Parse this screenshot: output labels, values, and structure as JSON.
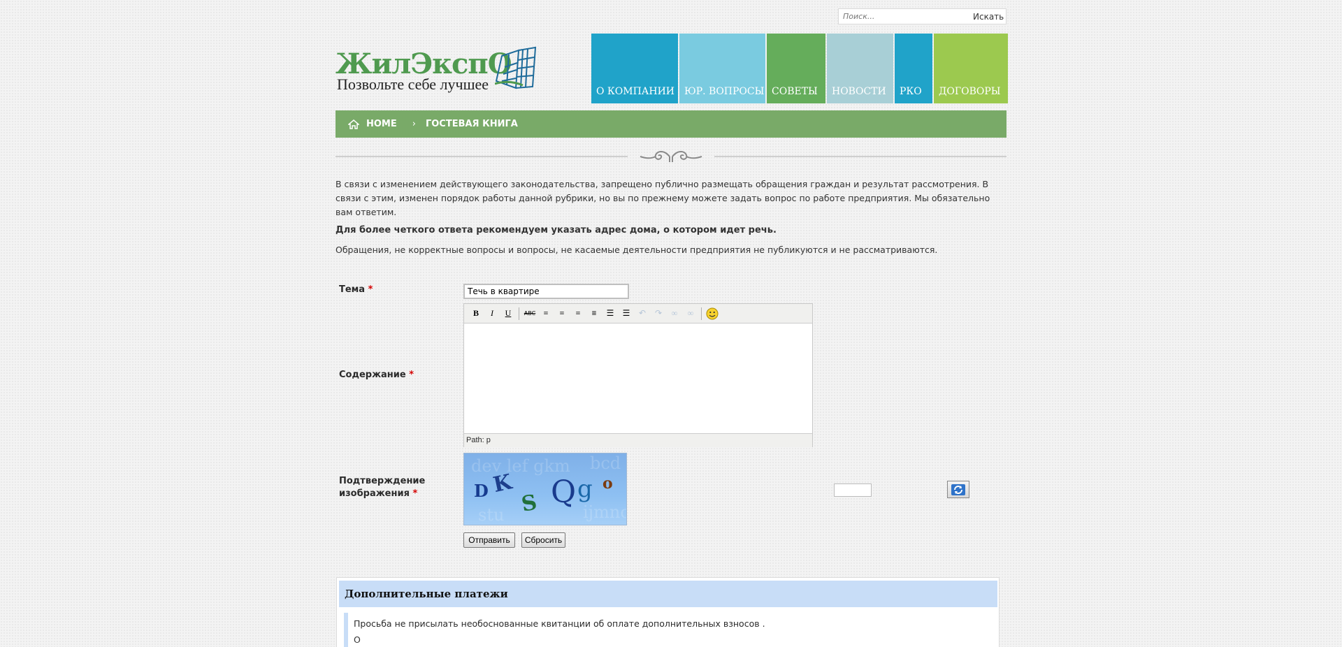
{
  "search": {
    "placeholder": "Поиск...",
    "button_label": "Искать"
  },
  "logo": {
    "title": "ЖилЭкспО",
    "tagline": "Позвольте себе лучшее"
  },
  "nav": {
    "items": [
      {
        "label": "О КОМПАНИИ",
        "color": "#20a3c9"
      },
      {
        "label": "ЮР. ВОПРОСЫ",
        "color": "#7acbe0"
      },
      {
        "label": "СОВЕТЫ",
        "color": "#65ad5b"
      },
      {
        "label": "НОВОСТИ",
        "color": "#a8cfd6"
      },
      {
        "label": "РКО",
        "color": "#20a3c9"
      },
      {
        "label": "ДОГОВОРЫ",
        "color": "#9cc94f"
      }
    ]
  },
  "breadcrumb": {
    "home": "HOME",
    "separator": "›",
    "current": "ГОСТЕВАЯ КНИГА"
  },
  "intro": {
    "p1": "В связи с изменением действующего законодательства, запрещено публично размещать обращения граждан и результат рассмотрения. В связи с этим, изменен порядок работы данной рубрики, но вы по прежнему можете задать вопрос по работе предприятия. Мы обязательно вам ответим.",
    "p2": "Для более четкого ответа рекомендуем указать адрес дома, о котором идет речь.",
    "p3": "Обращения, не корректные вопросы и вопросы, не касаемые деятельности предприятия не публикуются и не рассматриваются."
  },
  "form": {
    "subject_label": "Тема",
    "subject_value": "Течь в квартире",
    "content_label": "Содержание",
    "captcha_label_line1": "Подтверждение",
    "captcha_label_line2": "изображения",
    "required_mark": "*",
    "editor_path": "Path: p",
    "toolbar": {
      "bold": "B",
      "italic": "I",
      "underline": "U",
      "strike": "ABC",
      "align_left": "≡",
      "align_center": "≡",
      "align_right": "≡",
      "justify": "≡",
      "bullets": "☰",
      "numbered": "☰",
      "undo": "↶",
      "redo": "↷",
      "link": "∞",
      "unlink": "∞",
      "emoticon": "☺"
    },
    "captcha_text": "DKSQgo",
    "submit_label": "Отправить",
    "reset_label": "Сбросить"
  },
  "additional": {
    "title": "Дополнительные платежи",
    "text": "Просьба не присылать необоснованные квитанции об оплате дополнительных взносов .",
    "text2": "О"
  }
}
